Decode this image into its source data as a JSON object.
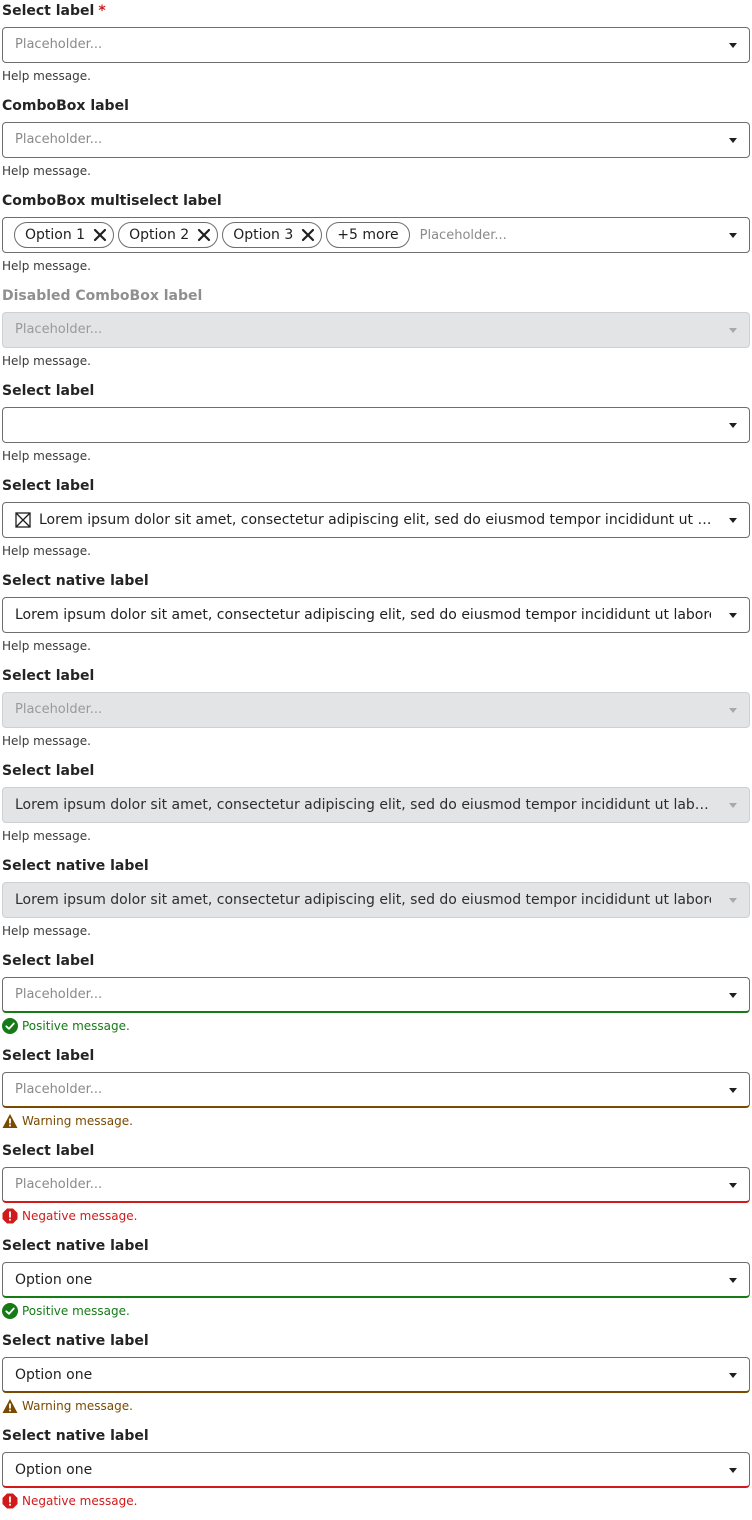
{
  "fields": [
    {
      "label": "Select label",
      "required_mark": "*",
      "placeholder": "Placeholder...",
      "help": "Help message."
    },
    {
      "label": "ComboBox label",
      "placeholder": "Placeholder...",
      "help": "Help message."
    },
    {
      "label": "ComboBox multiselect label",
      "chips": [
        "Option 1",
        "Option 2",
        "Option 3"
      ],
      "more": "+5 more",
      "placeholder": "Placeholder...",
      "help": "Help message."
    },
    {
      "label": "Disabled ComboBox label",
      "placeholder": "Placeholder...",
      "help": "Help message."
    },
    {
      "label": "Select label",
      "value": "",
      "help": "Help message."
    },
    {
      "label": "Select label",
      "value": "Lorem ipsum dolor sit amet, consectetur adipiscing elit, sed do eiusmod tempor incididunt ut labore et dolore magna aliqua.",
      "icon": "placeholder-box-icon",
      "help": "Help message."
    },
    {
      "label": "Select native label",
      "value": "Lorem ipsum dolor sit amet, consectetur adipiscing elit, sed do eiusmod tempor incididunt ut labore et",
      "help": "Help message."
    },
    {
      "label": "Select label",
      "placeholder": "Placeholder...",
      "help": "Help message."
    },
    {
      "label": "Select label",
      "value": "Lorem ipsum dolor sit amet, consectetur adipiscing elit, sed do eiusmod tempor incididunt ut labore et dolore magna aliqua.",
      "help": "Help message."
    },
    {
      "label": "Select native label",
      "value": "Lorem ipsum dolor sit amet, consectetur adipiscing elit, sed do eiusmod tempor incididunt ut labore et",
      "help": "Help message."
    },
    {
      "label": "Select label",
      "placeholder": "Placeholder...",
      "message": "Positive message."
    },
    {
      "label": "Select label",
      "placeholder": "Placeholder...",
      "message": "Warning message."
    },
    {
      "label": "Select label",
      "placeholder": "Placeholder...",
      "message": "Negative message."
    },
    {
      "label": "Select native label",
      "value": "Option one",
      "message": "Positive message."
    },
    {
      "label": "Select native label",
      "value": "Option one",
      "message": "Warning message."
    },
    {
      "label": "Select native label",
      "value": "Option one",
      "message": "Negative message."
    }
  ],
  "colors": {
    "positive": "#167a16",
    "warning": "#7a4a00",
    "negative": "#d11a1a",
    "disabled_bg": "#e3e4e5"
  }
}
